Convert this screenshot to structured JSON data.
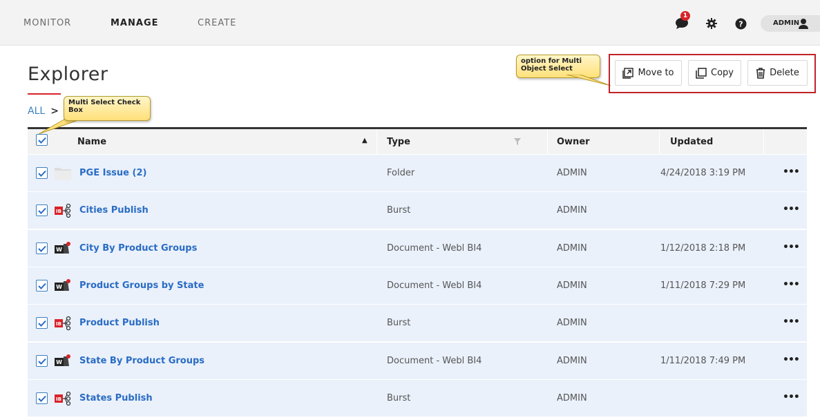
{
  "nav": {
    "items": [
      "MONITOR",
      "MANAGE",
      "CREATE"
    ],
    "active": "MANAGE",
    "notification_count": "1",
    "user": "ADMIN"
  },
  "page": {
    "title": "Explorer",
    "breadcrumb_root": "ALL",
    "breadcrumb_separator": ">"
  },
  "actions": {
    "move_to": "Move to",
    "copy": "Copy",
    "delete": "Delete"
  },
  "callouts": {
    "multi_object": "option for Multi Object Select",
    "multi_check": "Multi Select Check Box"
  },
  "table": {
    "columns": [
      "Name",
      "Type",
      "Owner",
      "Updated"
    ],
    "sort_indicator": "▲",
    "rows": [
      {
        "name": "PGE Issue",
        "count": "(2)",
        "type": "Folder",
        "owner": "ADMIN",
        "updated": "4/24/2018 3:19 PM",
        "icon": "folder-icon",
        "checked": true
      },
      {
        "name": "Cities Publish",
        "count": "",
        "type": "Burst",
        "owner": "ADMIN",
        "updated": "",
        "icon": "burst-publication-icon",
        "checked": true
      },
      {
        "name": "City By Product Groups",
        "count": "",
        "type": "Document - Webl BI4",
        "owner": "ADMIN",
        "updated": "1/12/2018 2:18 PM",
        "icon": "webi-document-icon",
        "checked": true
      },
      {
        "name": "Product Groups by State",
        "count": "",
        "type": "Document - Webl BI4",
        "owner": "ADMIN",
        "updated": "1/11/2018 7:29 PM",
        "icon": "webi-document-icon",
        "checked": true
      },
      {
        "name": "Product Publish",
        "count": "",
        "type": "Burst",
        "owner": "ADMIN",
        "updated": "",
        "icon": "burst-publication-icon",
        "checked": true
      },
      {
        "name": "State By Product Groups",
        "count": "",
        "type": "Document - Webl BI4",
        "owner": "ADMIN",
        "updated": "1/11/2018 7:49 PM",
        "icon": "webi-document-icon",
        "checked": true
      },
      {
        "name": "States Publish",
        "count": "",
        "type": "Burst",
        "owner": "ADMIN",
        "updated": "",
        "icon": "burst-publication-icon",
        "checked": true
      }
    ],
    "more_label": "•••"
  },
  "colors": {
    "accent_red": "#d8232a",
    "link_blue": "#2a6cc4",
    "row_selected": "#eaf1fb",
    "header_bg": "#f3f3f3"
  }
}
